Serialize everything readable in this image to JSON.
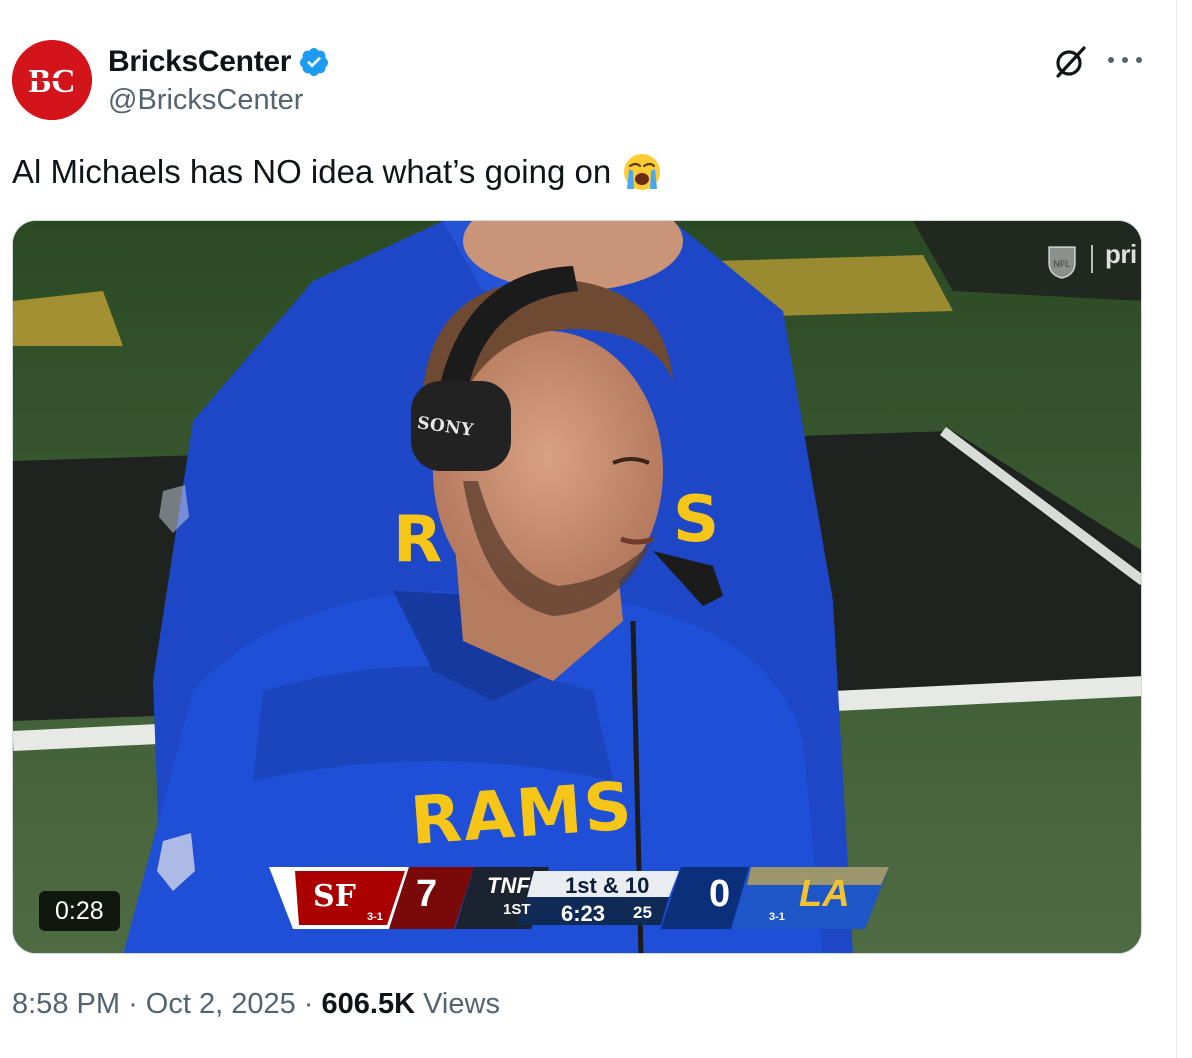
{
  "tweet": {
    "author": {
      "display_name": "BricksCenter",
      "handle": "@BricksCenter",
      "avatar_text": "BC",
      "verified": true
    },
    "text": "Al Michaels has NO idea what’s going on",
    "emoji": "loudly-crying-face",
    "media": {
      "type": "video",
      "duration": "0:28",
      "watermark_nfl": "NFL",
      "watermark_network": "pri",
      "scene_text": {
        "hoodie_front": "RAMS",
        "headset_brand": "SONY"
      },
      "scorebug": {
        "away_team": "SF",
        "away_score": "7",
        "away_record": "3-1",
        "network": "TNF",
        "quarter": "1ST",
        "down_distance": "1st & 10",
        "game_clock": "6:23",
        "play_clock": "25",
        "home_team": "LA",
        "home_score": "0",
        "home_record": "3-1"
      }
    },
    "timestamp": {
      "time": "8:58 PM",
      "separator": "·",
      "date": "Oct 2, 2025",
      "views_count": "606.5K",
      "views_label": "Views"
    }
  },
  "colors": {
    "verified_blue": "#1d9bf0",
    "avatar_red": "#d3141b",
    "text_primary": "#0f1419",
    "text_secondary": "#536471",
    "rams_blue": "#1f4fd1",
    "rams_gold": "#f5c518"
  },
  "icons": [
    "verified-badge-icon",
    "grok-icon",
    "more-options-icon",
    "loudly-crying-face-emoji",
    "nfl-shield-icon"
  ]
}
